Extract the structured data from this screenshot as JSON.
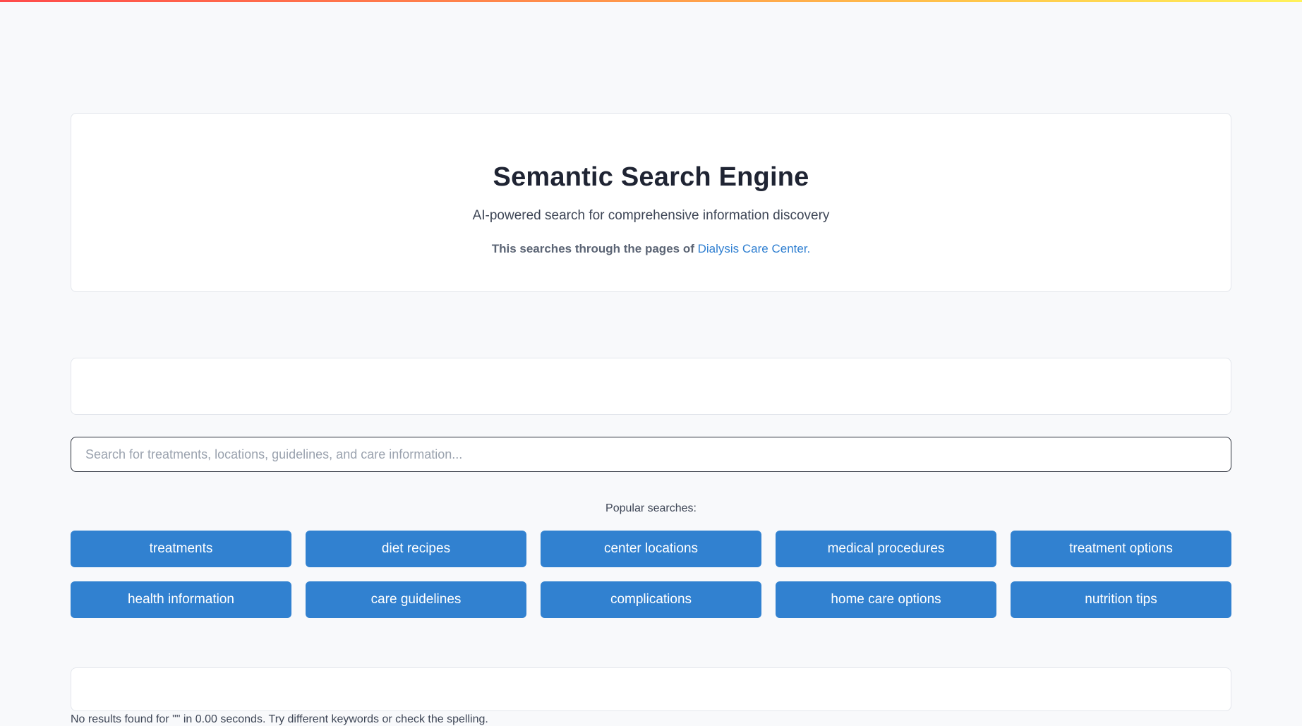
{
  "header": {
    "title": "Semantic Search Engine",
    "subtitle": "AI-powered search for comprehensive information discovery",
    "note_prefix": "This searches through the pages of",
    "note_link": "Dialysis Care Center."
  },
  "search": {
    "value": "",
    "placeholder": "Search for treatments, locations, guidelines, and care information..."
  },
  "popular": {
    "label": "Popular searches:",
    "items": [
      "treatments",
      "diet recipes",
      "center locations",
      "medical procedures",
      "treatment options",
      "health information",
      "care guidelines",
      "complications",
      "home care options",
      "nutrition tips"
    ]
  },
  "results": {
    "status": "No results found for \"\" in 0.00 seconds. Try different keywords or check the spelling."
  },
  "colors": {
    "accent": "#3181d0",
    "link": "#2f7fd1",
    "background": "#f8f9fb"
  }
}
